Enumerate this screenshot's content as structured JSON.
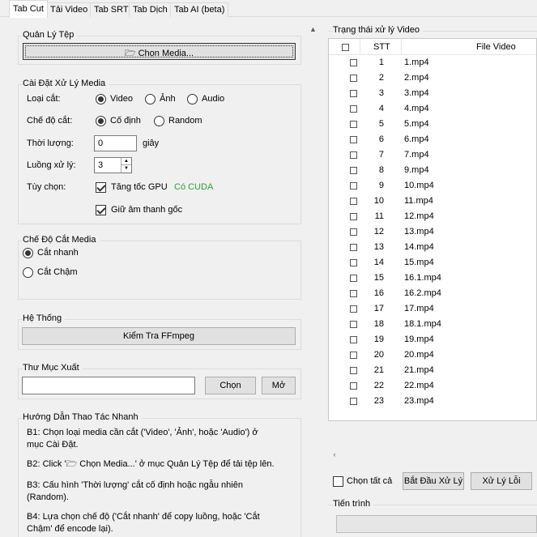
{
  "tabs": [
    {
      "label": "Tab Cut"
    },
    {
      "label": "Tải Video"
    },
    {
      "label": "Tab SRT"
    },
    {
      "label": "Tab Dịch"
    },
    {
      "label": "Tab AI (beta)"
    }
  ],
  "file_manager": {
    "title": "Quản Lý Tệp",
    "choose_media_label": "🗁 Chọn Media..."
  },
  "media_settings": {
    "title": "Cài Đặt Xử Lý Media",
    "cut_type_label": "Loại cắt:",
    "cut_type_options": [
      "Video",
      "Ảnh",
      "Audio"
    ],
    "cut_type_selected": "Video",
    "cut_mode_label": "Chế độ cắt:",
    "cut_mode_options": [
      "Cố định",
      "Random"
    ],
    "cut_mode_selected": "Cố định",
    "duration_label": "Thời lượng:",
    "duration_value": "0",
    "duration_unit": "giây",
    "threads_label": "Luồng xử lý:",
    "threads_value": "3",
    "options_label": "Tùy chọn:",
    "gpu_label": "Tăng tốc GPU",
    "gpu_checked": true,
    "cuda_status": "Có CUDA",
    "cuda_color": "#2e9e3e",
    "keep_audio_label": "Giữ âm thanh gốc",
    "keep_audio_checked": true
  },
  "cut_media_mode": {
    "title": "Chế Độ Cắt Media",
    "options": [
      "Cắt nhanh",
      "Cắt Chậm"
    ],
    "selected": "Cắt nhanh"
  },
  "system": {
    "title": "Hệ Thống",
    "check_ffmpeg_label": "Kiểm Tra FFmpeg"
  },
  "output_folder": {
    "title": "Thư Mục Xuất",
    "path_value": "",
    "choose_label": "Chọn",
    "open_label": "Mở"
  },
  "guide": {
    "title": "Hướng Dẫn Thao Tác Nhanh",
    "steps": [
      {
        "line1": "B1: Chọn loại media cần cắt ('Video', 'Ảnh', hoặc 'Audio') ở",
        "line2": "mục Cài Đặt."
      },
      {
        "line1": "B2: Click '🗁 Chọn Media...' ở mục Quản Lý Tệp để tải tệp lên.",
        "line2": ""
      },
      {
        "line1": "B3: Cấu hình 'Thời lượng' cắt cố định hoặc ngẫu nhiên",
        "line2": "(Random)."
      },
      {
        "line1": "B4: Lựa chọn chế độ ('Cắt nhanh' để copy luồng, hoặc 'Cắt",
        "line2": "Chậm' để encode lại)."
      }
    ]
  },
  "video_status": {
    "title": "Trạng thái xử lý Video",
    "columns": {
      "stt": "STT",
      "file": "File Video"
    },
    "rows": [
      {
        "stt": "1",
        "file": "1.mp4"
      },
      {
        "stt": "2",
        "file": "2.mp4"
      },
      {
        "stt": "3",
        "file": "3.mp4"
      },
      {
        "stt": "4",
        "file": "4.mp4"
      },
      {
        "stt": "5",
        "file": "5.mp4"
      },
      {
        "stt": "6",
        "file": "6.mp4"
      },
      {
        "stt": "7",
        "file": "7.mp4"
      },
      {
        "stt": "8",
        "file": "9.mp4"
      },
      {
        "stt": "9",
        "file": "10.mp4"
      },
      {
        "stt": "10",
        "file": "11.mp4"
      },
      {
        "stt": "11",
        "file": "12.mp4"
      },
      {
        "stt": "12",
        "file": "13.mp4"
      },
      {
        "stt": "13",
        "file": "14.mp4"
      },
      {
        "stt": "14",
        "file": "15.mp4"
      },
      {
        "stt": "15",
        "file": "16.1.mp4"
      },
      {
        "stt": "16",
        "file": "16.2.mp4"
      },
      {
        "stt": "17",
        "file": "17.mp4"
      },
      {
        "stt": "18",
        "file": "18.1.mp4"
      },
      {
        "stt": "19",
        "file": "19.mp4"
      },
      {
        "stt": "20",
        "file": "20.mp4"
      },
      {
        "stt": "21",
        "file": "21.mp4"
      },
      {
        "stt": "22",
        "file": "22.mp4"
      },
      {
        "stt": "23",
        "file": "23.mp4"
      }
    ]
  },
  "actions": {
    "select_all_label": "Chọn tất cả",
    "start_label": "Bắt Đầu Xử Lý",
    "error_label": "Xử Lý Lỗi"
  },
  "progress": {
    "title": "Tiến trình",
    "value": 0
  }
}
